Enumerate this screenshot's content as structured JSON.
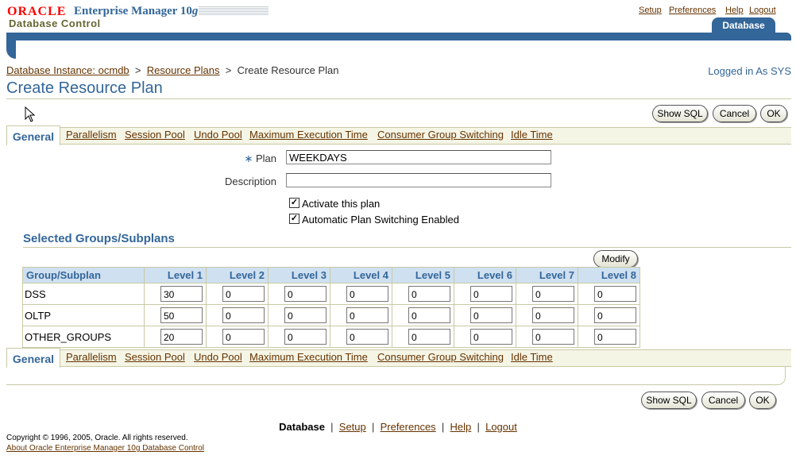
{
  "header": {
    "oracle": "ORACLE",
    "product": "Enterprise Manager 10",
    "product_g": "g",
    "subtitle": "Database Control",
    "global_links": [
      "Setup",
      "Preferences",
      "Help",
      "Logout"
    ],
    "active_tab": "Database"
  },
  "breadcrumb": {
    "item1": "Database Instance: ocmdb",
    "item2": "Resource Plans",
    "current": "Create Resource Plan"
  },
  "logged_in": "Logged in As SYS",
  "page_title": "Create Resource Plan",
  "buttons": {
    "show_sql": "Show SQL",
    "cancel": "Cancel",
    "ok": "OK",
    "modify": "Modify"
  },
  "subtabs": [
    "General",
    "Parallelism",
    "Session Pool",
    "Undo Pool",
    "Maximum Execution Time",
    "Consumer Group Switching",
    "Idle Time"
  ],
  "form": {
    "plan_label": "Plan",
    "plan_value": "WEEKDAYS",
    "description_label": "Description",
    "description_value": "",
    "activate_label": "Activate this plan",
    "activate_checked": true,
    "auto_switch_label": "Automatic Plan Switching Enabled",
    "auto_switch_checked": true
  },
  "section_title": "Selected Groups/Subplans",
  "table": {
    "headers": [
      "Group/Subplan",
      "Level 1",
      "Level 2",
      "Level 3",
      "Level 4",
      "Level 5",
      "Level 6",
      "Level 7",
      "Level 8"
    ],
    "rows": [
      {
        "name": "DSS",
        "levels": [
          "30",
          "0",
          "0",
          "0",
          "0",
          "0",
          "0",
          "0"
        ]
      },
      {
        "name": "OLTP",
        "levels": [
          "50",
          "0",
          "0",
          "0",
          "0",
          "0",
          "0",
          "0"
        ]
      },
      {
        "name": "OTHER_GROUPS",
        "levels": [
          "20",
          "0",
          "0",
          "0",
          "0",
          "0",
          "0",
          "0"
        ]
      }
    ]
  },
  "footer": {
    "nav_current": "Database",
    "nav_links": [
      "Setup",
      "Preferences",
      "Help",
      "Logout"
    ],
    "copyright": "Copyright © 1996, 2005, Oracle. All rights reserved.",
    "about": "About Oracle Enterprise Manager 10g Database Control"
  }
}
